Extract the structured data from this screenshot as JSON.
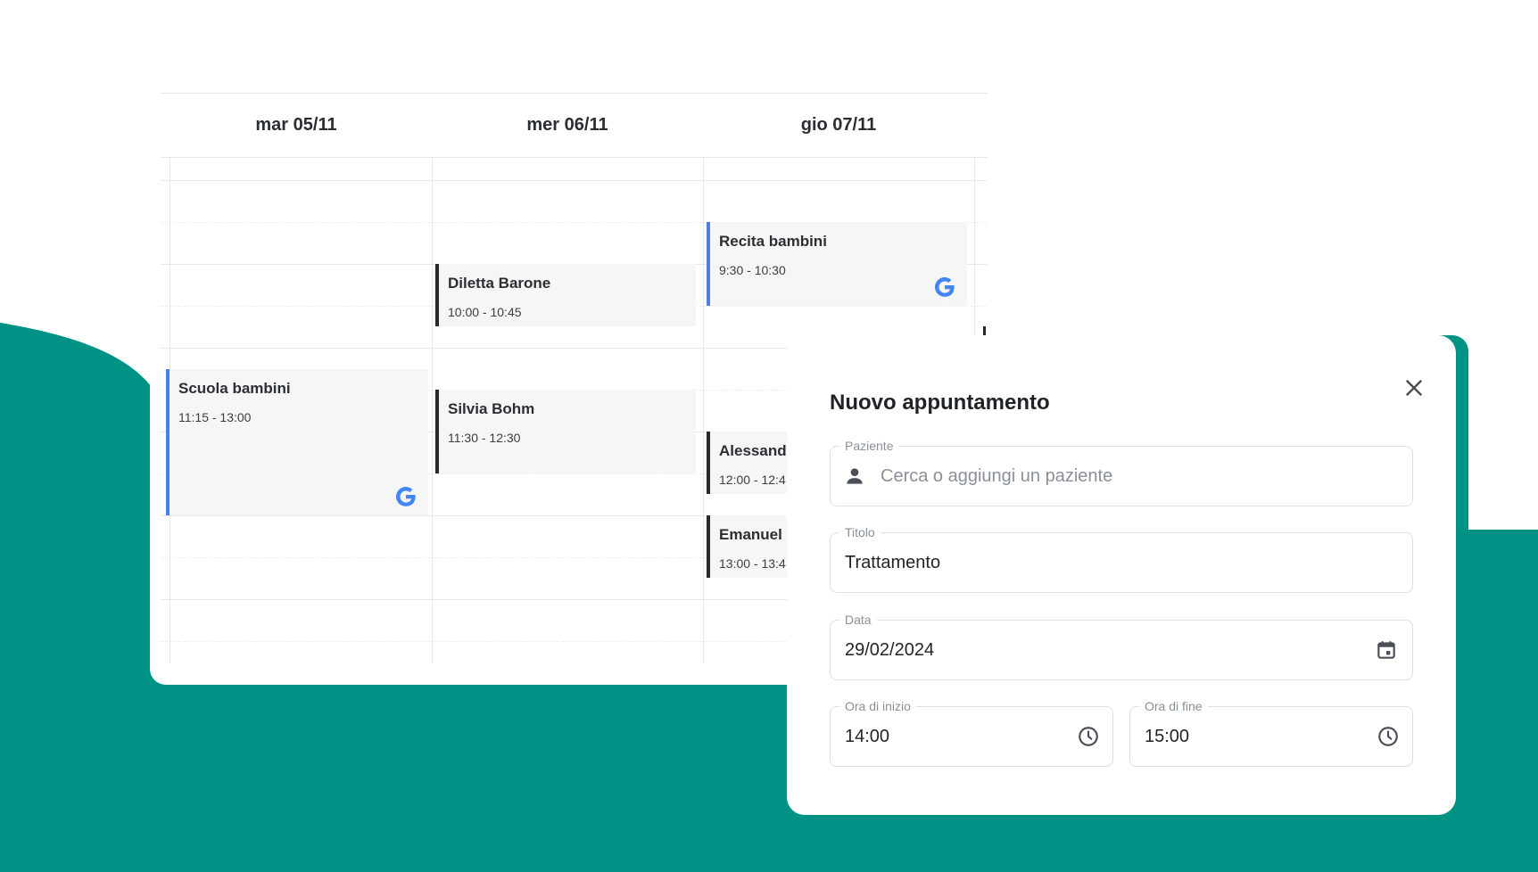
{
  "colors": {
    "brand": "#009385",
    "google_blue": "#4a7fe6",
    "event_bar_dark": "#2a2a2a"
  },
  "calendar": {
    "days": [
      {
        "label": "mar 05/11"
      },
      {
        "label": "mer 06/11"
      },
      {
        "label": "gio 07/11"
      }
    ],
    "events": [
      {
        "title": "Recita bambini",
        "time": "9:30 - 10:30",
        "source_icon": "google-icon"
      },
      {
        "title": "Diletta Barone",
        "time": "10:00 - 10:45"
      },
      {
        "title": "Scuola bambini",
        "time": "11:15 - 13:00",
        "source_icon": "google-icon"
      },
      {
        "title": "Silvia Bohm",
        "time": "11:30 - 12:30"
      },
      {
        "title": "Alessand",
        "time": "12:00 - 12:4"
      },
      {
        "title": "Emanuel",
        "time": "13:00 - 13:4"
      }
    ]
  },
  "modal": {
    "title": "Nuovo appuntamento",
    "close_icon": "close-icon",
    "patient": {
      "label": "Paziente",
      "placeholder": "Cerca o aggiungi un paziente",
      "icon": "person-icon"
    },
    "title_field": {
      "label": "Titolo",
      "value": "Trattamento"
    },
    "date": {
      "label": "Data",
      "value": "29/02/2024",
      "icon": "calendar-icon"
    },
    "start_time": {
      "label": "Ora di inizio",
      "value": "14:00",
      "icon": "clock-icon"
    },
    "end_time": {
      "label": "Ora di fine",
      "value": "15:00",
      "icon": "clock-icon"
    }
  }
}
